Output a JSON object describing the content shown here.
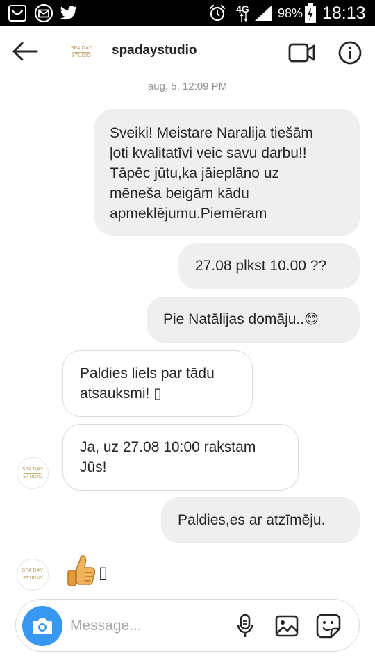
{
  "status_bar": {
    "network": "4G",
    "battery": "98%",
    "time": "18:13"
  },
  "header": {
    "username": "spadaystudio",
    "avatar_logo": {
      "line1": "SPA DAY",
      "line2": "STUDIO"
    }
  },
  "conversation": {
    "timestamp": "aug. 5, 12:09 PM",
    "messages": [
      {
        "sender": "me",
        "lines": [
          "Sveiki! Meistare Naralija tiešām",
          "ļoti kvalitatīvi veic savu darbu!!",
          "Tāpēc jūtu,ka jāieplāno uz",
          "mēneša beigām kādu",
          "apmeklējumu.Piemēram"
        ]
      },
      {
        "sender": "me",
        "lines": [
          "27.08 plkst 10.00 ??"
        ]
      },
      {
        "sender": "me",
        "lines": [
          "Pie Natālijas domāju.."
        ],
        "emoji": "😊"
      },
      {
        "sender": "them",
        "lines": [
          "Paldies liels par tādu",
          "atsauksmi! ▯"
        ]
      },
      {
        "sender": "them",
        "lines": [
          "Ja, uz 27.08 10:00 rakstam",
          "Jūs!"
        ]
      },
      {
        "sender": "me",
        "lines": [
          "Paldies,es ar atzīmēju."
        ]
      },
      {
        "sender": "them",
        "emoji": "👍",
        "trailing": "▯"
      }
    ]
  },
  "composer": {
    "placeholder": "Message..."
  },
  "colors": {
    "accent": "#3897f0",
    "outgoing_bubble": "#efefef",
    "incoming_border": "#dbdbdb",
    "thumb": "#f0b35c"
  }
}
